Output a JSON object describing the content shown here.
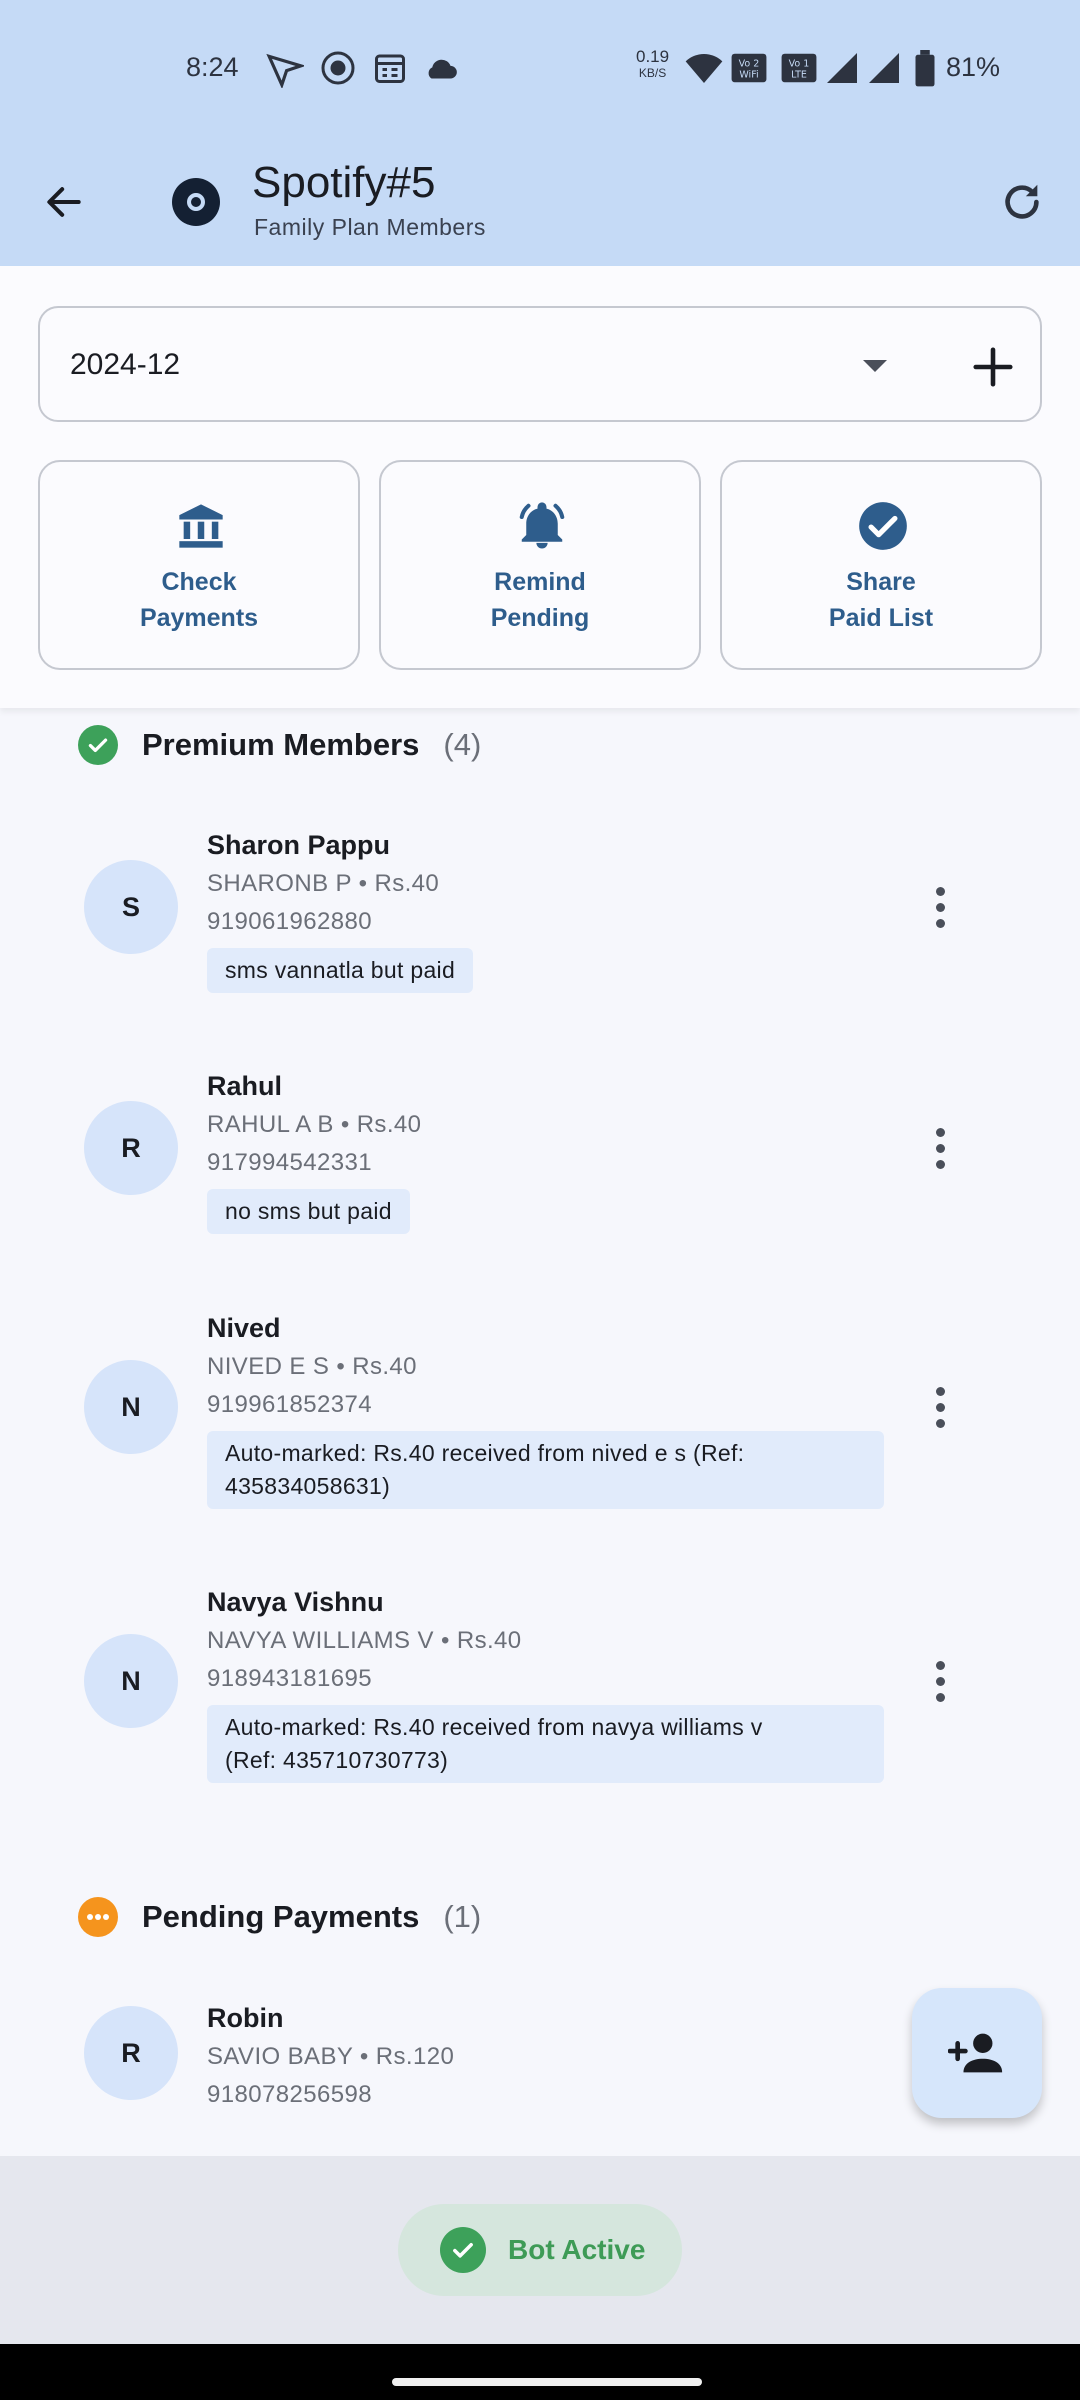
{
  "status_bar": {
    "time": "8:24",
    "net_speed": "0.19",
    "net_unit": "KB/S",
    "battery": "81%",
    "icons": [
      "navigation-icon",
      "github-icon",
      "calendar-icon",
      "cloud-icon",
      "wifi-icon",
      "vowifi-icon",
      "volte-icon",
      "signal-icon",
      "signal-icon",
      "battery-icon"
    ]
  },
  "app_bar": {
    "title": "Spotify#5",
    "subtitle": "Family Plan Members"
  },
  "month_selector": {
    "value": "2024-12"
  },
  "actions": [
    {
      "line1": "Check",
      "line2": "Payments",
      "icon": "bank-icon"
    },
    {
      "line1": "Remind",
      "line2": "Pending",
      "icon": "bell-icon"
    },
    {
      "line1": "Share",
      "line2": "Paid List",
      "icon": "check-circle-icon"
    }
  ],
  "premium": {
    "title": "Premium Members",
    "count": "(4)",
    "members": [
      {
        "initial": "S",
        "name": "Sharon Pappu",
        "info": "SHARONB P • Rs.40",
        "phone": "919061962880",
        "note": "sms vannatla but paid"
      },
      {
        "initial": "R",
        "name": "Rahul",
        "info": "RAHUL A B • Rs.40",
        "phone": "917994542331",
        "note": "no sms but paid"
      },
      {
        "initial": "N",
        "name": "Nived",
        "info": "NIVED E S • Rs.40",
        "phone": "919961852374",
        "note_l1": "Auto-marked: Rs.40 received from nived e s (Ref:",
        "note_l2": "435834058631)"
      },
      {
        "initial": "N",
        "name": "Navya Vishnu",
        "info": "NAVYA WILLIAMS V • Rs.40",
        "phone": "918943181695",
        "note_l1": "Auto-marked: Rs.40 received from navya williams v",
        "note_l2": "(Ref: 435710730773)"
      }
    ]
  },
  "pending": {
    "title": "Pending Payments",
    "count": "(1)",
    "members": [
      {
        "initial": "R",
        "name": "Robin",
        "info": "SAVIO BABY • Rs.120",
        "phone": "918078256598"
      }
    ]
  },
  "bot_status": {
    "label": "Bot Active"
  },
  "colors": {
    "app_bar": "#c5daf6",
    "accent": "#2e5d8c",
    "premium": "#3da15a",
    "pending": "#f5941d"
  }
}
